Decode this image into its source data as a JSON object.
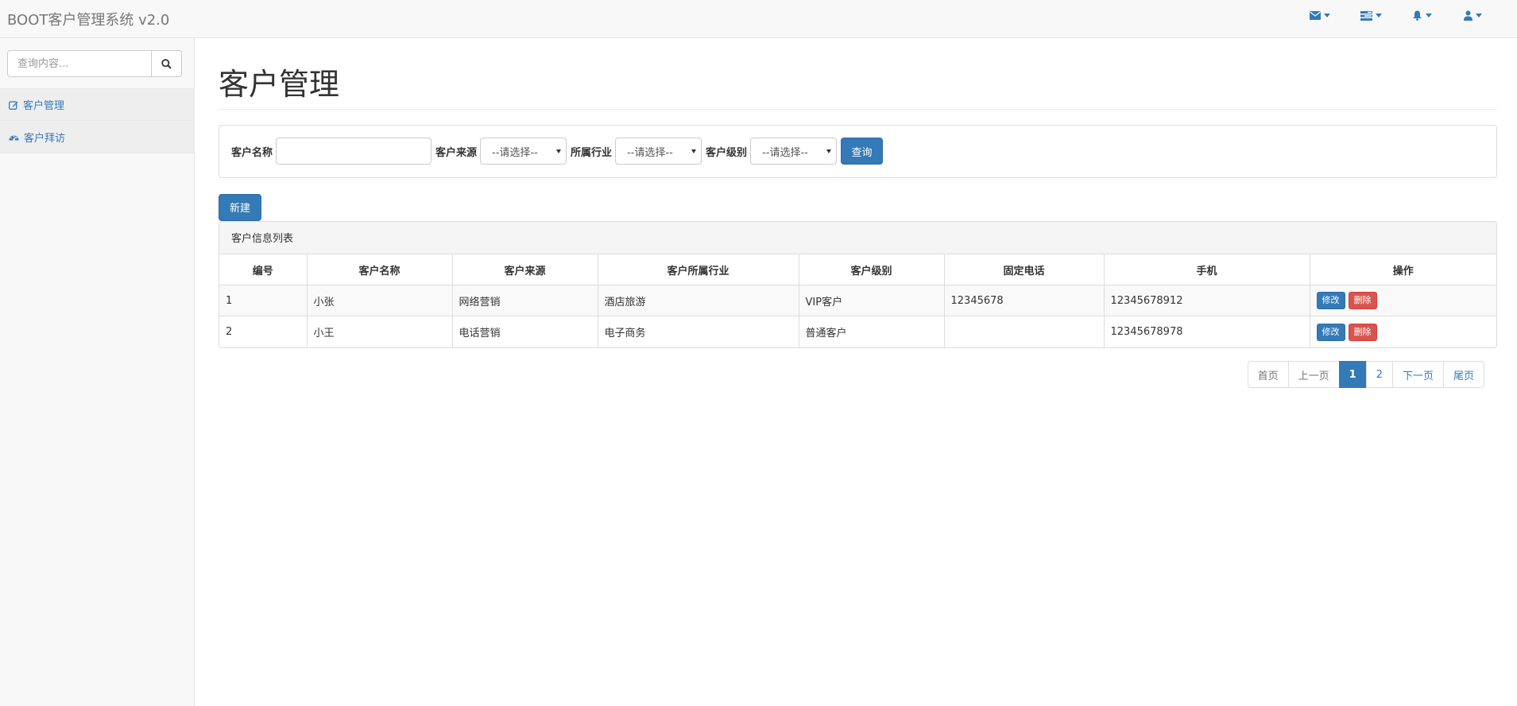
{
  "navbar": {
    "brand": "BOOT客户管理系统 v2.0",
    "icons": [
      "envelope-icon",
      "tasks-icon",
      "bell-icon",
      "user-icon"
    ]
  },
  "sidebar": {
    "search_placeholder": "查询内容...",
    "items": [
      {
        "label": "客户管理",
        "icon": "edit-icon"
      },
      {
        "label": "客户拜访",
        "icon": "dashboard-icon"
      }
    ]
  },
  "main": {
    "title": "客户管理",
    "filters": {
      "name_label": "客户名称",
      "name_value": "",
      "source_label": "客户来源",
      "source_value": "--请选择--",
      "industry_label": "所属行业",
      "industry_value": "--请选择--",
      "level_label": "客户级别",
      "level_value": "--请选择--",
      "query_label": "查询"
    },
    "new_label": "新建",
    "list_title": "客户信息列表",
    "columns": [
      "编号",
      "客户名称",
      "客户来源",
      "客户所属行业",
      "客户级别",
      "固定电话",
      "手机",
      "操作"
    ],
    "rows": [
      {
        "id": "1",
        "name": "小张",
        "source": "网络营销",
        "industry": "酒店旅游",
        "level": "VIP客户",
        "phone": "12345678",
        "mobile": "12345678912"
      },
      {
        "id": "2",
        "name": "小王",
        "source": "电话营销",
        "industry": "电子商务",
        "level": "普通客户",
        "phone": "",
        "mobile": "12345678978"
      }
    ],
    "row_actions": {
      "edit": "修改",
      "delete": "删除"
    },
    "pagination": {
      "first": "首页",
      "prev": "上一页",
      "pages": [
        "1",
        "2"
      ],
      "current": "1",
      "next": "下一页",
      "last": "尾页"
    }
  },
  "colors": {
    "primary": "#337ab7",
    "danger": "#d9534f",
    "navbar_bg": "#f8f8f8"
  }
}
